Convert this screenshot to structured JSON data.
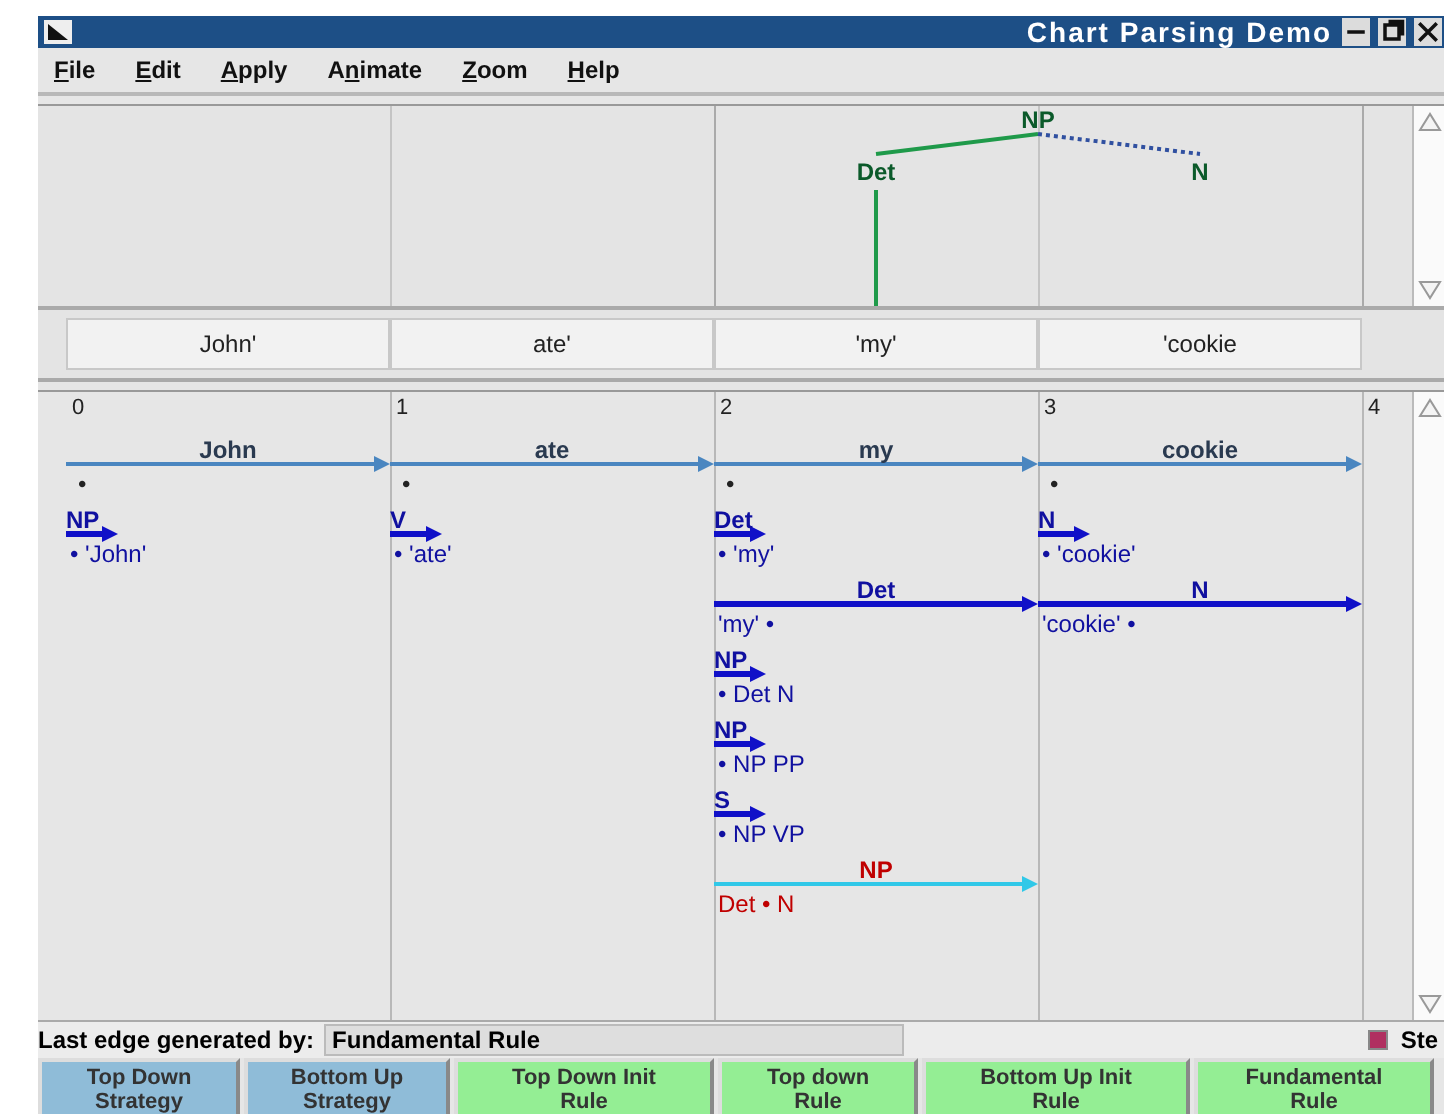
{
  "window": {
    "title": "Chart Parsing Demo"
  },
  "menu": [
    {
      "key": "F",
      "rest": "ile"
    },
    {
      "key": "E",
      "rest": "dit"
    },
    {
      "key": "A",
      "rest": "pply"
    },
    {
      "before": "A",
      "key": "n",
      "rest": "imate"
    },
    {
      "key": "Z",
      "rest": "oom"
    },
    {
      "key": "H",
      "rest": "elp"
    }
  ],
  "tree": {
    "label": "NP",
    "children": [
      {
        "label": "Det",
        "found": true
      },
      {
        "label": "N",
        "found": false
      }
    ]
  },
  "tokens": [
    "John'",
    "ate'",
    "'my'",
    "'cookie"
  ],
  "chart": {
    "nodes": [
      {
        "label": "0",
        "edges": [
          {
            "kind": "leaf",
            "label": "John",
            "rule": "•"
          },
          {
            "kind": "predicted",
            "label": "NP",
            "rule": "• 'John'"
          }
        ]
      },
      {
        "label": "1",
        "edges": [
          {
            "kind": "leaf",
            "label": "ate",
            "rule": "•"
          },
          {
            "kind": "predicted",
            "label": "V",
            "rule": "• 'ate'"
          }
        ]
      },
      {
        "label": "2",
        "edges": [
          {
            "kind": "leaf",
            "label": "my",
            "rule": "•"
          },
          {
            "kind": "predicted",
            "label": "Det",
            "rule": "• 'my'"
          },
          {
            "kind": "complete",
            "label": "Det",
            "rule": "'my' •"
          },
          {
            "kind": "predicted",
            "label": "NP",
            "rule": "• Det N"
          },
          {
            "kind": "predicted",
            "label": "NP",
            "rule": "• NP PP"
          },
          {
            "kind": "predicted",
            "label": "S",
            "rule": "• NP VP"
          },
          {
            "kind": "new",
            "label": "NP",
            "rule": "Det • N"
          }
        ]
      },
      {
        "label": "3",
        "edges": [
          {
            "kind": "leaf",
            "label": "cookie",
            "rule": "•"
          },
          {
            "kind": "predicted",
            "label": "N",
            "rule": "• 'cookie'"
          },
          {
            "kind": "complete",
            "label": "N",
            "rule": "'cookie' •"
          }
        ]
      },
      {
        "label": "4"
      }
    ]
  },
  "status": {
    "label": "Last edge generated by:",
    "value": "Fundamental Rule",
    "step": {
      "label": "Ste",
      "checked": true
    }
  },
  "buttons": [
    {
      "kind": "strategy",
      "lines": [
        "Top Down",
        "Strategy"
      ]
    },
    {
      "kind": "strategy",
      "lines": [
        "Bottom Up",
        "Strategy"
      ]
    },
    {
      "kind": "rule",
      "lines": [
        "Top Down Init",
        "Rule"
      ]
    },
    {
      "kind": "rule",
      "lines": [
        "Top down",
        "Rule"
      ]
    },
    {
      "kind": "rule",
      "lines": [
        "Bottom Up Init",
        "Rule"
      ]
    },
    {
      "kind": "rule",
      "lines": [
        "Fundamental",
        "Rule"
      ]
    }
  ]
}
